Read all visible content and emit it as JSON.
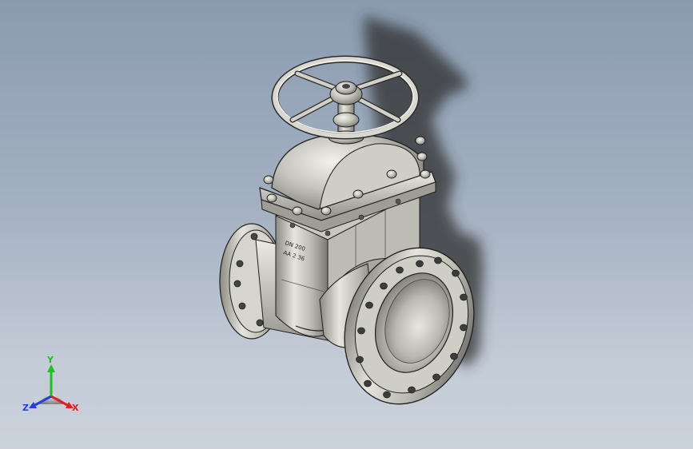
{
  "viewport": {
    "background_top": "#8a9bb0",
    "background_bottom": "#cbd2dc"
  },
  "model": {
    "part_color": "#bdbcb4",
    "edge_color": "#1e1e1e",
    "shadow_color": "#3a3a3a",
    "body_marking_line1": "DN 200",
    "body_marking_line2": "AA 2 36"
  },
  "triad": {
    "x_label": "X",
    "y_label": "Y",
    "z_label": "Z",
    "x_color": "#e02020",
    "y_color": "#20c020",
    "z_color": "#2040e0"
  }
}
